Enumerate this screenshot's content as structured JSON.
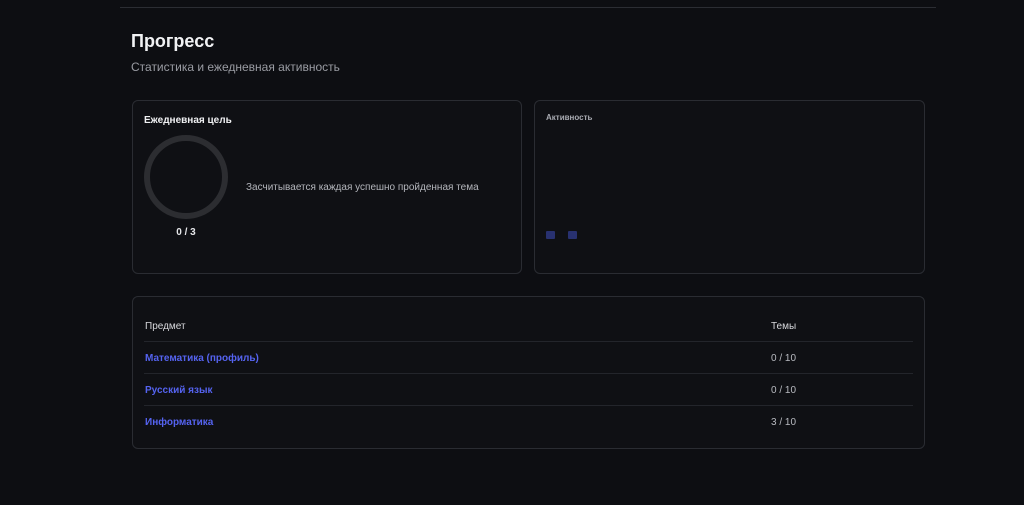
{
  "header": {
    "title": "Прогресс",
    "subtitle": "Статистика и ежедневная активность"
  },
  "daily_goal": {
    "title": "Ежедневная цель",
    "done": 0,
    "target": 3,
    "count_text": "0 / 3",
    "hint": "Засчитывается каждая успешно пройденная тема",
    "ring_color": "#2c2d31"
  },
  "activity": {
    "title": "Активность",
    "cell_color": "#283170",
    "cells": [
      {
        "level": 1
      },
      {
        "level": 1
      }
    ]
  },
  "subjects": {
    "columns": {
      "name": "Предмет",
      "topics": "Темы"
    },
    "link_color": "#5563f0",
    "rows": [
      {
        "name": "Математика (профиль)",
        "topics": "0 / 10"
      },
      {
        "name": "Русский язык",
        "topics": "0 / 10"
      },
      {
        "name": "Информатика",
        "topics": "3 / 10"
      }
    ]
  }
}
